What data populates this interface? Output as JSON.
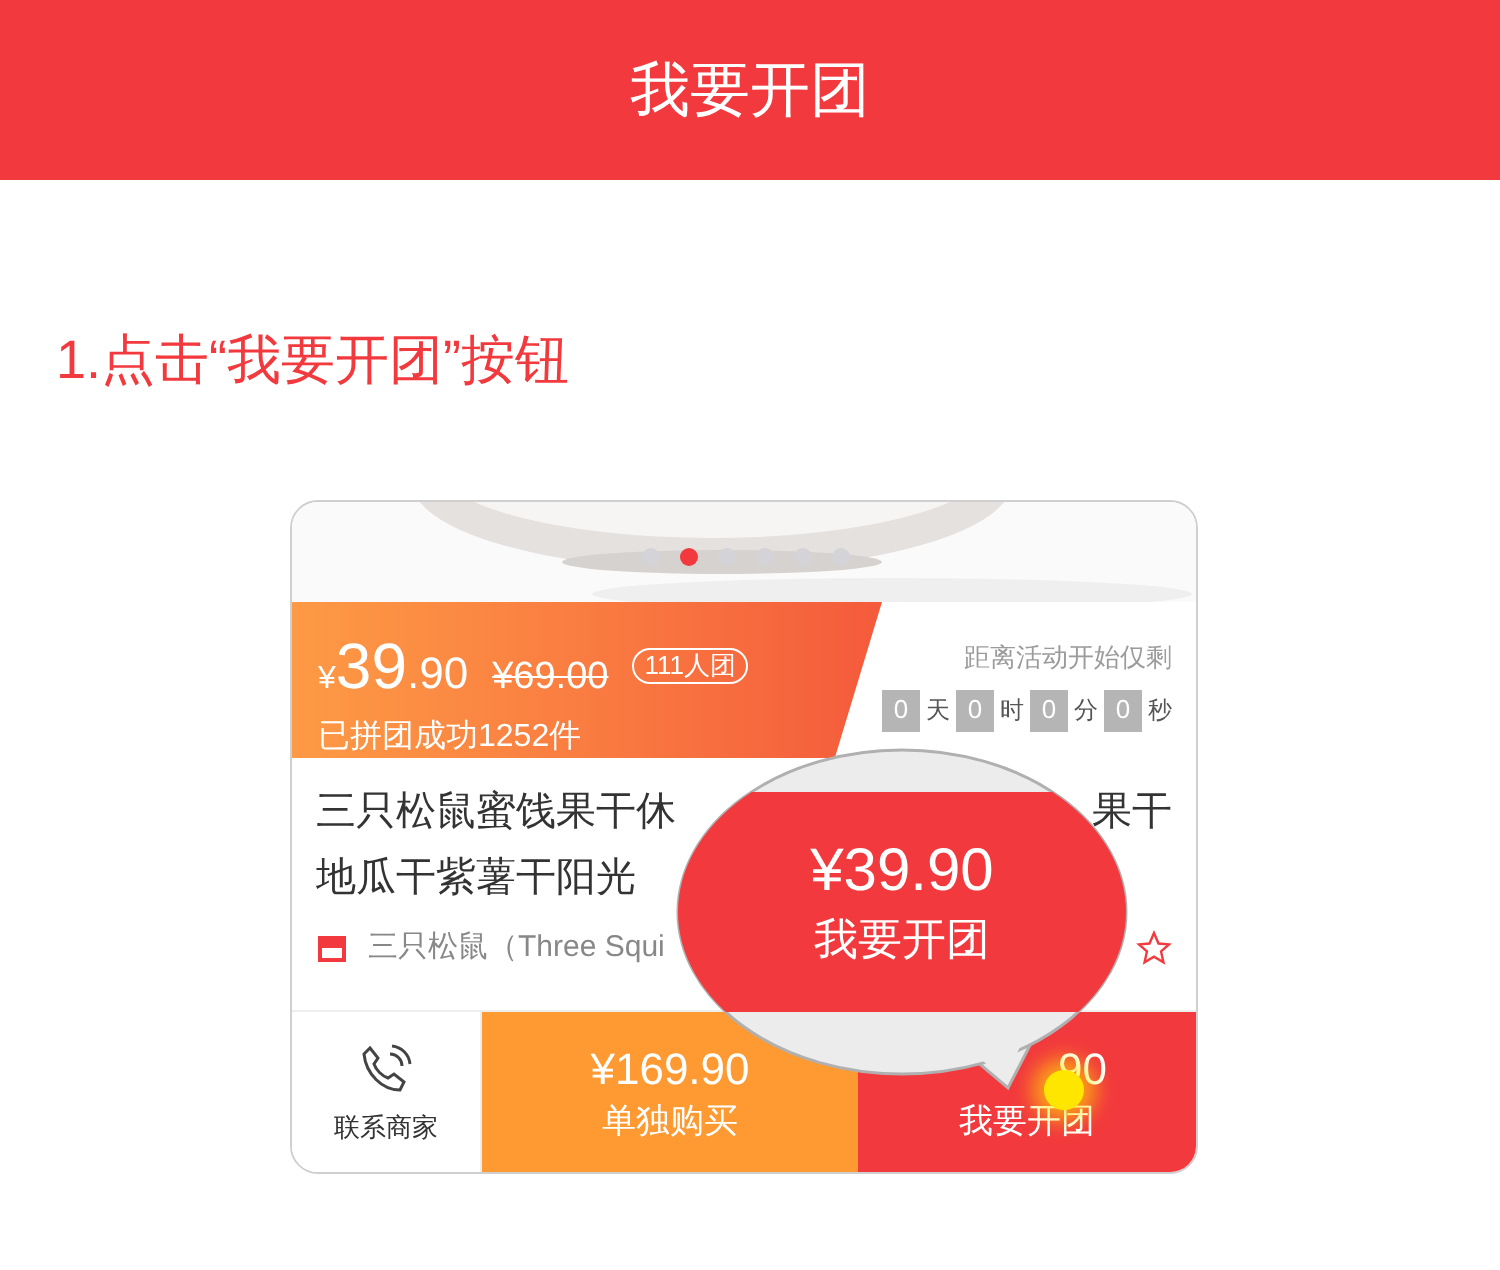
{
  "header": {
    "title": "我要开团"
  },
  "step": {
    "text": "1.点击“我要开团”按钮"
  },
  "product": {
    "carousel_dots": [
      {
        "selected": false
      },
      {
        "selected": true
      },
      {
        "selected": false
      },
      {
        "selected": false
      },
      {
        "selected": false
      },
      {
        "selected": false
      }
    ],
    "group_price": {
      "currency": "¥",
      "integer": "39",
      "decimal": ".90"
    },
    "original_price": "¥69.00",
    "group_size_badge": "111人团",
    "sold_count": "已拼团成功1252件",
    "countdown": {
      "label": "距离活动开始仅剩",
      "units": [
        {
          "value": "0",
          "unit": "天"
        },
        {
          "value": "0",
          "unit": "时"
        },
        {
          "value": "0",
          "unit": "分"
        },
        {
          "value": "0",
          "unit": "秒"
        }
      ]
    },
    "title_lines": [
      {
        "start": "三只松鼠蜜饯果干休",
        "end": "果干"
      },
      {
        "start": "地瓜干紫薯干阳光"
      }
    ],
    "shop_name": "三只松鼠（Three Squi",
    "bottom_bar": [
      {
        "kind": "contact",
        "label": "联系商家"
      },
      {
        "kind": "solo",
        "price": "¥169.90",
        "label": "单独购买"
      },
      {
        "kind": "group",
        "price": "90",
        "label": "我要开团"
      }
    ]
  },
  "callout": {
    "price": "¥39.90",
    "label": "我要开团"
  }
}
